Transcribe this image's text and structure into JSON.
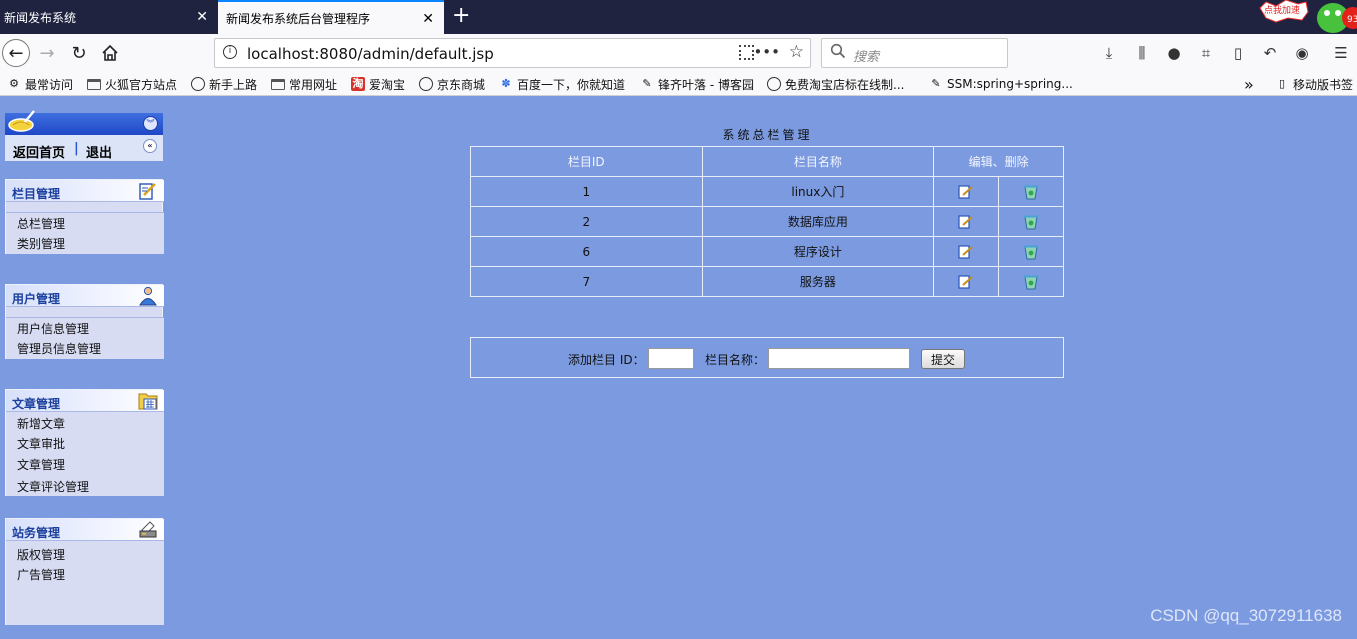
{
  "browser": {
    "tabs": [
      {
        "title": "新闻发布系统",
        "active": false
      },
      {
        "title": "新闻发布系统后台管理程序",
        "active": true
      }
    ],
    "new_tab_symbol": "+",
    "tab_close_symbol": "✕",
    "url": "localhost:8080/admin/default.jsp",
    "search_placeholder": "搜索",
    "addon": {
      "label": "点我加速",
      "count": "93"
    },
    "bookmarks": [
      {
        "label": "最常访问",
        "icon": "gear-icon"
      },
      {
        "label": "火狐官方站点",
        "icon": "folder-icon"
      },
      {
        "label": "新手上路",
        "icon": "globe-icon"
      },
      {
        "label": "常用网址",
        "icon": "folder-icon"
      },
      {
        "label": "爱淘宝",
        "icon": "taobao-icon"
      },
      {
        "label": "京东商城",
        "icon": "globe-icon"
      },
      {
        "label": "百度一下，你就知道",
        "icon": "baidu-icon"
      },
      {
        "label": "锋齐叶落 - 博客园",
        "icon": "pen-icon"
      },
      {
        "label": "免费淘宝店标在线制...",
        "icon": "globe-icon"
      },
      {
        "label": "SSM:spring+spring...",
        "icon": "pen-icon"
      }
    ],
    "bookmarks_overflow": "»",
    "mobile_bookmarks": "移动版书签"
  },
  "sidebar": {
    "home_link": "返回首页",
    "separator": "|",
    "logout_link": "退出",
    "panels": [
      {
        "title": "栏目管理",
        "icon": "edit-icon",
        "items": [
          "总栏管理",
          "类别管理"
        ]
      },
      {
        "title": "用户管理",
        "icon": "user-icon",
        "items": [
          "用户信息管理",
          "管理员信息管理"
        ]
      },
      {
        "title": "文章管理",
        "icon": "calendar-folder-icon",
        "items": [
          "新增文章",
          "文章审批",
          "文章管理",
          "文章评论管理"
        ]
      },
      {
        "title": "站务管理",
        "icon": "printer-icon",
        "items": [
          "版权管理",
          "广告管理"
        ]
      }
    ]
  },
  "main": {
    "title": "系统总栏管理",
    "table": {
      "headers": [
        "栏目ID",
        "栏目名称",
        "编辑、删除"
      ],
      "rows": [
        {
          "id": "1",
          "name": "linux入门"
        },
        {
          "id": "2",
          "name": "数据库应用"
        },
        {
          "id": "6",
          "name": "程序设计"
        },
        {
          "id": "7",
          "name": "服务器"
        }
      ]
    },
    "form": {
      "id_label": "添加栏目 ID：",
      "id_value": "",
      "name_label": "栏目名称：",
      "name_value": "",
      "submit_label": "提交"
    }
  },
  "watermark": "CSDN @qq_3072911638",
  "colors": {
    "page_background": "#7b9ae0",
    "panel_title": "#1a3f9c",
    "logo_bar": "#1f48c6",
    "panel_body": "#d7dcf3",
    "tabbar": "#202340"
  }
}
